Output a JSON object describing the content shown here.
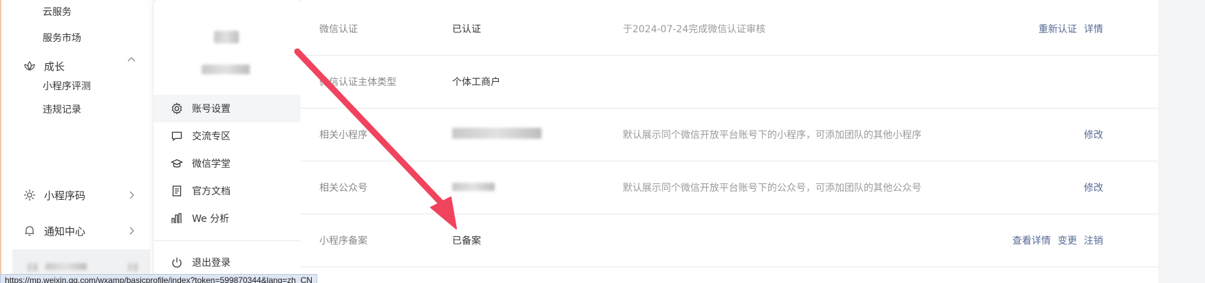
{
  "sidebar": {
    "sub_items_top": [
      "云服务",
      "服务市场"
    ],
    "group_growth": "成长",
    "sub_items_growth": [
      "小程序评测",
      "违规记录"
    ],
    "group_qrcode": "小程序码",
    "group_notify": "通知中心"
  },
  "popup": {
    "items": [
      {
        "label": "账号设置",
        "icon": "gear-icon"
      },
      {
        "label": "交流专区",
        "icon": "chat-icon"
      },
      {
        "label": "微信学堂",
        "icon": "graduation-cap-icon"
      },
      {
        "label": "官方文档",
        "icon": "document-icon"
      },
      {
        "label": "We 分析",
        "icon": "analytics-icon"
      }
    ],
    "logout": "退出登录"
  },
  "rows": [
    {
      "label": "微信认证",
      "value": "已认证",
      "desc": "于2024-07-24完成微信认证审核",
      "actions": [
        "重新认证",
        "详情"
      ]
    },
    {
      "label": "微信认证主体类型",
      "value": "个体工商户",
      "desc": "",
      "actions": []
    },
    {
      "label": "相关小程序",
      "value": "",
      "desc": "默认展示同个微信开放平台账号下的小程序，可添加团队的其他小程序",
      "actions": [
        "修改"
      ]
    },
    {
      "label": "相关公众号",
      "value": "",
      "desc": "默认展示同个微信开放平台账号下的公众号，可添加团队的其他公众号",
      "actions": [
        "修改"
      ]
    },
    {
      "label": "小程序备案",
      "value": "已备案",
      "desc": "",
      "actions": [
        "查看详情",
        "变更",
        "注销"
      ]
    }
  ],
  "statusbar": {
    "url": "https://mp.weixin.qq.com/wxamp/basicprofile/index?token=599870344&lang=zh_CN"
  },
  "colors": {
    "link": "#576b95",
    "arrow": "#f0435d"
  }
}
